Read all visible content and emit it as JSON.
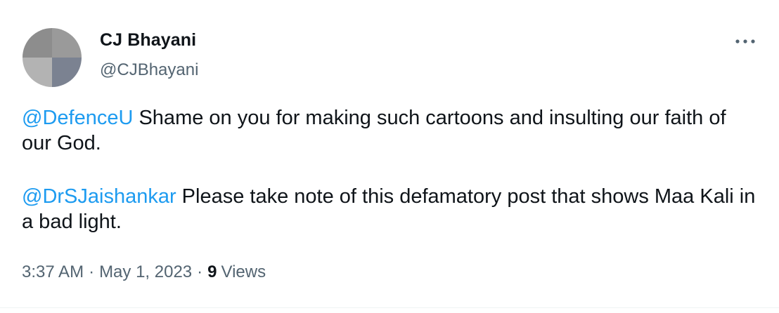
{
  "author": {
    "name": "CJ Bhayani",
    "handle": "@CJBhayani"
  },
  "more_icon": "more-horizontal-icon",
  "tweet": {
    "paragraph1": {
      "mention": "@DefenceU",
      "text": " Shame on you for making such cartoons and insulting our faith of our God."
    },
    "paragraph2": {
      "mention": "@DrSJaishankar",
      "text": " Please take note of this defamatory post that shows Maa Kali in a bad light."
    }
  },
  "meta": {
    "time": "3:37 AM",
    "separator": "·",
    "date": "May 1, 2023",
    "views_count": "9",
    "views_label": "Views"
  },
  "colors": {
    "accent": "#1d9bf0",
    "secondary_text": "#536471",
    "primary_text": "#0f1419"
  }
}
